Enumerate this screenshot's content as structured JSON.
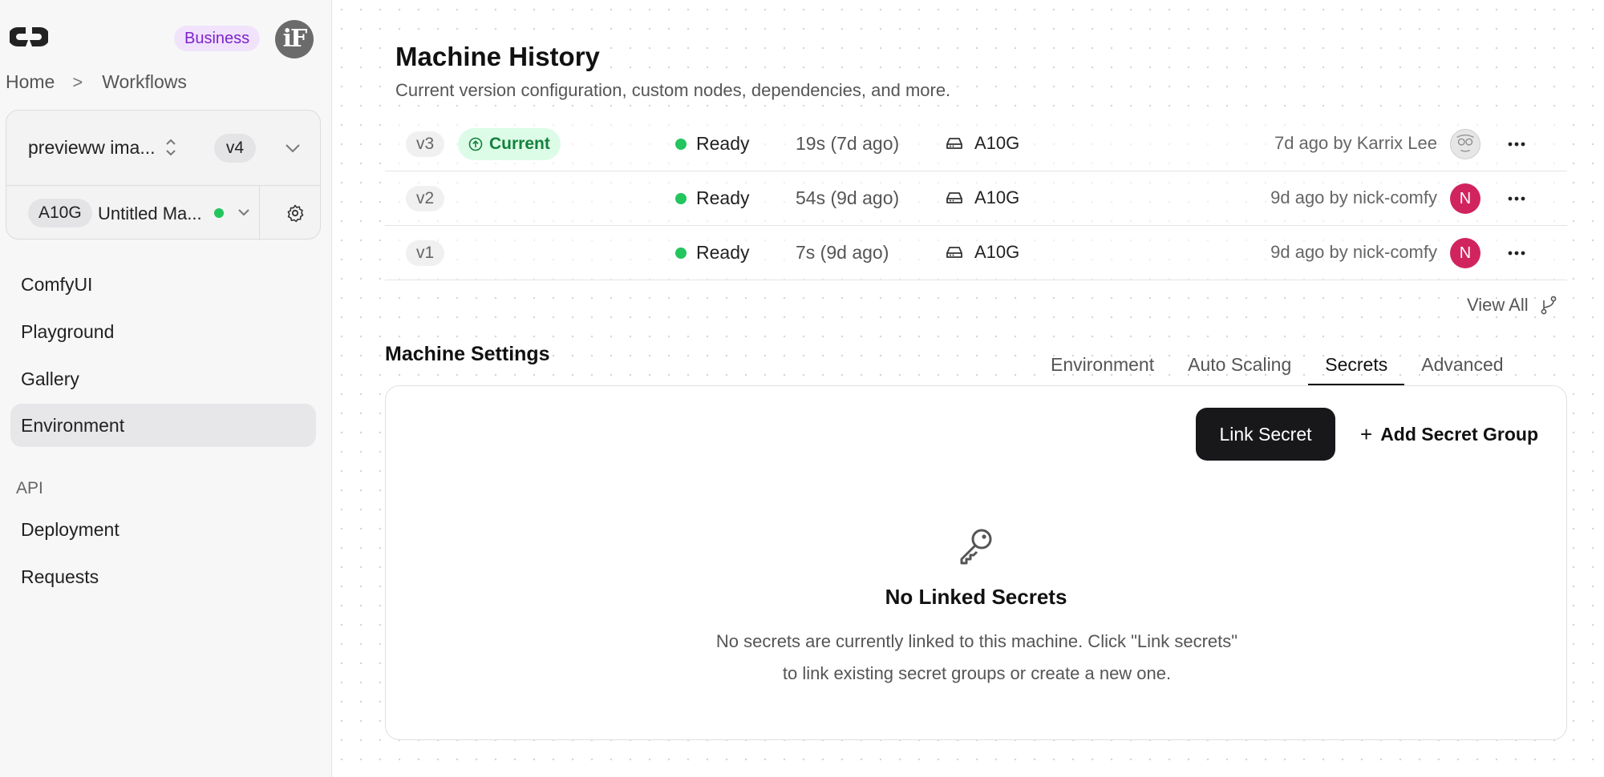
{
  "sidebar": {
    "plan_badge": "Business",
    "avatar_initials": "iF",
    "breadcrumb": {
      "home": "Home",
      "sep": ">",
      "current": "Workflows"
    },
    "workflow_name": "previeww ima...",
    "workflow_version": "v4",
    "gpu": "A10G",
    "machine_name": "Untitled Ma...",
    "nav": [
      {
        "label": "ComfyUI"
      },
      {
        "label": "Playground"
      },
      {
        "label": "Gallery"
      },
      {
        "label": "Environment",
        "active": true
      }
    ],
    "api_section": "API",
    "api_nav": [
      {
        "label": "Deployment"
      },
      {
        "label": "Requests"
      }
    ]
  },
  "main": {
    "title": "Machine History",
    "subtitle": "Current version configuration, custom nodes, dependencies, and more.",
    "history": [
      {
        "version": "v3",
        "current_label": "Current",
        "status": "Ready",
        "duration": "19s (7d ago)",
        "gpu": "A10G",
        "by": "7d ago by Karrix Lee",
        "avatar": "photo"
      },
      {
        "version": "v2",
        "status": "Ready",
        "duration": "54s (9d ago)",
        "gpu": "A10G",
        "by": "9d ago by nick-comfy",
        "avatar": "N"
      },
      {
        "version": "v1",
        "status": "Ready",
        "duration": "7s (9d ago)",
        "gpu": "A10G",
        "by": "9d ago by nick-comfy",
        "avatar": "N"
      }
    ],
    "view_all": "View All",
    "settings_title": "Machine Settings",
    "tabs": [
      {
        "label": "Environment"
      },
      {
        "label": "Auto Scaling"
      },
      {
        "label": "Secrets",
        "active": true
      },
      {
        "label": "Advanced"
      }
    ],
    "secrets": {
      "link_button": "Link Secret",
      "add_group_plus": "+",
      "add_group": "Add Secret Group",
      "empty_title": "No Linked Secrets",
      "empty_line1": "No secrets are currently linked to this machine. Click \"Link secrets\"",
      "empty_line2": "to link existing secret groups or create a new one."
    }
  },
  "colors": {
    "accent_dark": "#18181b",
    "ready_green": "#22c55e",
    "current_bg": "#dcfce7",
    "current_text": "#15803d",
    "business_bg": "#f1e3fb",
    "business_text": "#7e22ce",
    "user_avatar": "#d1245e"
  }
}
